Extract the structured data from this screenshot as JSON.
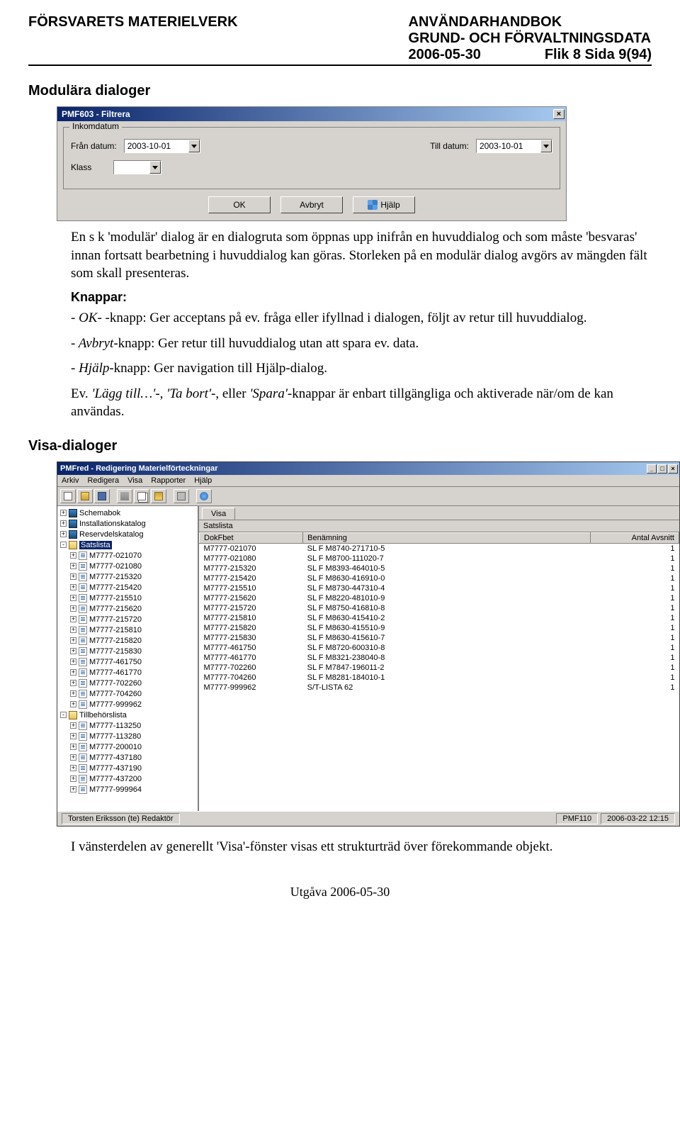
{
  "header": {
    "left": "FÖRSVARETS MATERIELVERK",
    "right1": "ANVÄNDARHANDBOK",
    "right2": "GRUND- OCH FÖRVALTNINGSDATA",
    "right3a": "2006-05-30",
    "right3b": "Flik 8  Sida 9(94)"
  },
  "section1": "Modulära dialoger",
  "dialog": {
    "title": "PMF603 - Filtrera",
    "group_legend": "Inkomdatum",
    "from_label": "Från datum:",
    "from_value": "2003-10-01",
    "to_label": "Till datum:",
    "to_value": "2003-10-01",
    "klass_label": "Klass",
    "klass_value": "",
    "ok": "OK",
    "cancel": "Avbryt",
    "help": "Hjälp"
  },
  "para1": "En s k 'modulär' dialog är en dialogruta som öppnas upp inifrån en huvuddialog och som måste 'besvaras' innan fortsatt bearbetning i huvuddialog kan göras. Storleken på en modulär dialog avgörs av mängden fält som skall presenteras.",
  "knappar_heading": "Knappar:",
  "knapp_ok": "- OK- -knapp:  Ger acceptans på ev. fråga eller ifyllnad i dialogen, följt av retur till huvuddialog.",
  "knapp_avbryt": "- Avbryt-knapp:  Ger retur till huvuddialog utan att spara ev. data.",
  "knapp_hjalp": "- Hjälp-knapp:  Ger navigation till Hjälp-dialog.",
  "knapp_ev": "Ev. 'Lägg till…'-, 'Ta bort'-, eller 'Spara'-knappar är enbart tillgängliga och aktiverade när/om de kan användas.",
  "section2": "Visa-dialoger",
  "app": {
    "title": "PMFred - Redigering Materielförteckningar",
    "menu": [
      "Arkiv",
      "Redigera",
      "Visa",
      "Rapporter",
      "Hjälp"
    ],
    "tree_top": [
      {
        "icon": "book",
        "label": "Schemabok",
        "exp": "+"
      },
      {
        "icon": "book",
        "label": "Installationskatalog",
        "exp": "+"
      },
      {
        "icon": "book",
        "label": "Reservdelskatalog",
        "exp": "+"
      },
      {
        "icon": "fold-o",
        "label": "Satslista",
        "exp": "-",
        "sel": true
      }
    ],
    "tree_sats": [
      "M7777-021070",
      "M7777-021080",
      "M7777-215320",
      "M7777-215420",
      "M7777-215510",
      "M7777-215620",
      "M7777-215720",
      "M7777-215810",
      "M7777-215820",
      "M7777-215830",
      "M7777-461750",
      "M7777-461770",
      "M7777-702260",
      "M7777-704260",
      "M7777-999962"
    ],
    "tree_tillbehor_label": "Tillbehörslista",
    "tree_tillbehor": [
      "M7777-113250",
      "M7777-113280",
      "M7777-200010",
      "M7777-437180",
      "M7777-437190",
      "M7777-437200",
      "M7777-999964"
    ],
    "tab": "Visa",
    "list_label": "Satslista",
    "columns": [
      "DokFbet",
      "Benämning",
      "Antal Avsnitt"
    ],
    "rows": [
      [
        "M7777-021070",
        "SL F M8740-271710-5",
        "1"
      ],
      [
        "M7777-021080",
        "SL F M8700-111020-7",
        "1"
      ],
      [
        "M7777-215320",
        "SL F M8393-464010-5",
        "1"
      ],
      [
        "M7777-215420",
        "SL F M8630-416910-0",
        "1"
      ],
      [
        "M7777-215510",
        "SL F M8730-447310-4",
        "1"
      ],
      [
        "M7777-215620",
        "SL F M8220-481010-9",
        "1"
      ],
      [
        "M7777-215720",
        "SL F M8750-416810-8",
        "1"
      ],
      [
        "M7777-215810",
        "SL F M8630-415410-2",
        "1"
      ],
      [
        "M7777-215820",
        "SL F M8630-415510-9",
        "1"
      ],
      [
        "M7777-215830",
        "SL F M8630-415610-7",
        "1"
      ],
      [
        "M7777-461750",
        "SL F M8720-600310-8",
        "1"
      ],
      [
        "M7777-461770",
        "SL F M8321-238040-8",
        "1"
      ],
      [
        "M7777-702260",
        "SL F M7847-196011-2",
        "1"
      ],
      [
        "M7777-704260",
        "SL F M8281-184010-1",
        "1"
      ],
      [
        "M7777-999962",
        "S/T-LISTA 62",
        "1"
      ]
    ],
    "status_left": "Torsten Eriksson (te) Redaktör",
    "status_mid": "PMF110",
    "status_right": "2006-03-22  12:15"
  },
  "para_after_app": "I vänsterdelen av generellt 'Visa'-fönster visas ett strukturträd över förekommande objekt.",
  "footer": "Utgåva 2006-05-30"
}
